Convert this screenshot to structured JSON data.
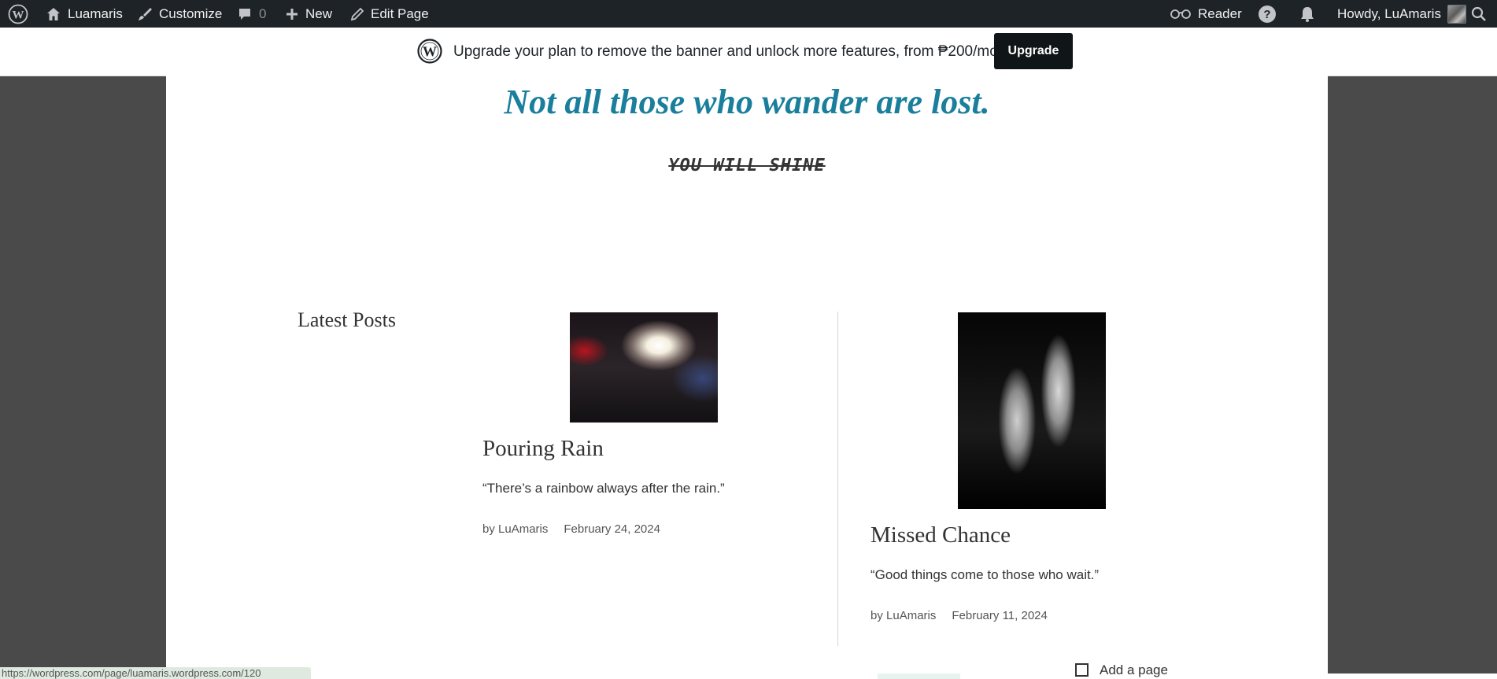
{
  "admin_bar": {
    "site_name": "Luamaris",
    "customize": "Customize",
    "comments_count": "0",
    "new": "New",
    "edit_page": "Edit Page",
    "reader": "Reader",
    "greeting": "Howdy, LuAmaris"
  },
  "banner": {
    "text": "Upgrade your plan to remove the banner and unlock more features, from ₱200/month",
    "button": "Upgrade"
  },
  "page": {
    "tagline": "Not all those who wander are lost.",
    "subtitle": "YOU WILL SHINE",
    "section_title": "Latest Posts",
    "posts": [
      {
        "title": "Pouring Rain",
        "excerpt": "“There’s a rainbow always after the rain.”",
        "author": "by LuAmaris",
        "date": "February 24, 2024"
      },
      {
        "title": "Missed Chance",
        "excerpt": "“Good things come to those who wait.”",
        "author": "by LuAmaris",
        "date": "February 11, 2024"
      }
    ]
  },
  "status_bar": {
    "url": "https://wordpress.com/page/luamaris.wordpress.com/120"
  },
  "bottom": {
    "add_page": "Add a page"
  },
  "colors": {
    "admin_bar": "#1d2327",
    "tagline": "#1a7f9c",
    "upgrade_button": "#101517",
    "backdrop": "#4a4a4a"
  },
  "icons": {
    "wp_logo": "wordpress-logo-icon",
    "home": "home-icon",
    "customize": "brush-icon",
    "comments": "comment-bubble-icon",
    "new": "plus-icon",
    "edit": "pencil-icon",
    "reader": "glasses-icon",
    "help": "help-icon",
    "notifications": "bell-icon",
    "search": "search-icon"
  }
}
